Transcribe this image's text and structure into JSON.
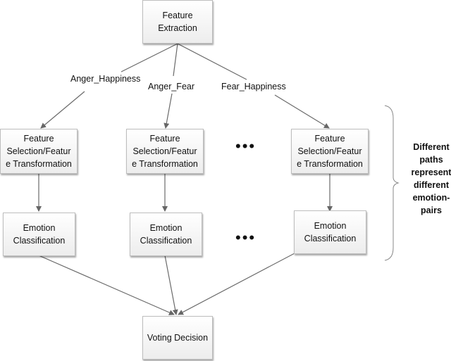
{
  "diagram": {
    "top_node": {
      "line1": "Feature",
      "line2": "Extraction"
    },
    "edge_labels": [
      "Anger_Happiness",
      "Anger_Fear",
      "Fear_Happiness"
    ],
    "selection_nodes": [
      {
        "line1": "Feature",
        "line2": "Selection/Featur",
        "line3": "e Transformation"
      },
      {
        "line1": "Feature",
        "line2": "Selection/Featur",
        "line3": "e Transformation"
      },
      {
        "line1": "Feature",
        "line2": "Selection/Featur",
        "line3": "e Transformation"
      }
    ],
    "classification_nodes": [
      {
        "line1": "Emotion",
        "line2": "Classification"
      },
      {
        "line1": "Emotion",
        "line2": "Classification"
      },
      {
        "line1": "Emotion",
        "line2": "Classification"
      }
    ],
    "ellipsis": "•••",
    "bottom_node": {
      "label": "Voting Decision"
    },
    "brace_note": {
      "lines": [
        "Different",
        "paths",
        "represent",
        "different",
        "emotion-",
        "pairs"
      ]
    }
  }
}
